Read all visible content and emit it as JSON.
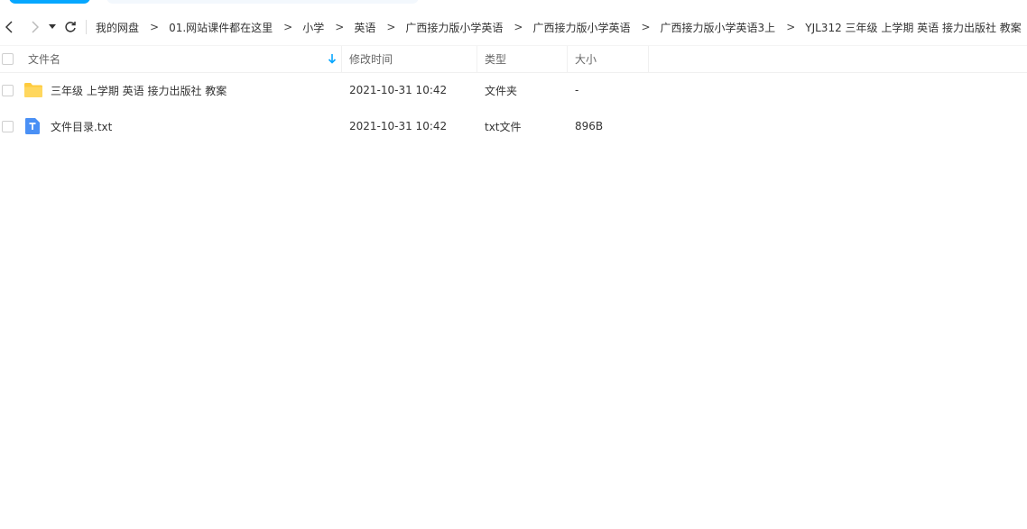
{
  "breadcrumb": {
    "items": [
      "我的网盘",
      "01.网站课件都在这里",
      "小学",
      "英语",
      "广西接力版小学英语",
      "广西接力版小学英语",
      "广西接力版小学英语3上",
      "YJL312 三年级 上学期 英语 接力出版社 教案"
    ],
    "separator": ">"
  },
  "table": {
    "columns": {
      "name": "文件名",
      "time": "修改时间",
      "type": "类型",
      "size": "大小"
    },
    "rows": [
      {
        "icon": "folder-icon",
        "name": "三年级 上学期 英语 接力出版社 教案",
        "time": "2021-10-31 10:42",
        "type": "文件夹",
        "size": "-"
      },
      {
        "icon": "text-file-icon",
        "name": "文件目录.txt",
        "time": "2021-10-31 10:42",
        "type": "txt文件",
        "size": "896B"
      }
    ]
  },
  "colors": {
    "accent": "#06a7ff",
    "folder": "#ffcb3d",
    "text_file": "#4a90f5"
  }
}
